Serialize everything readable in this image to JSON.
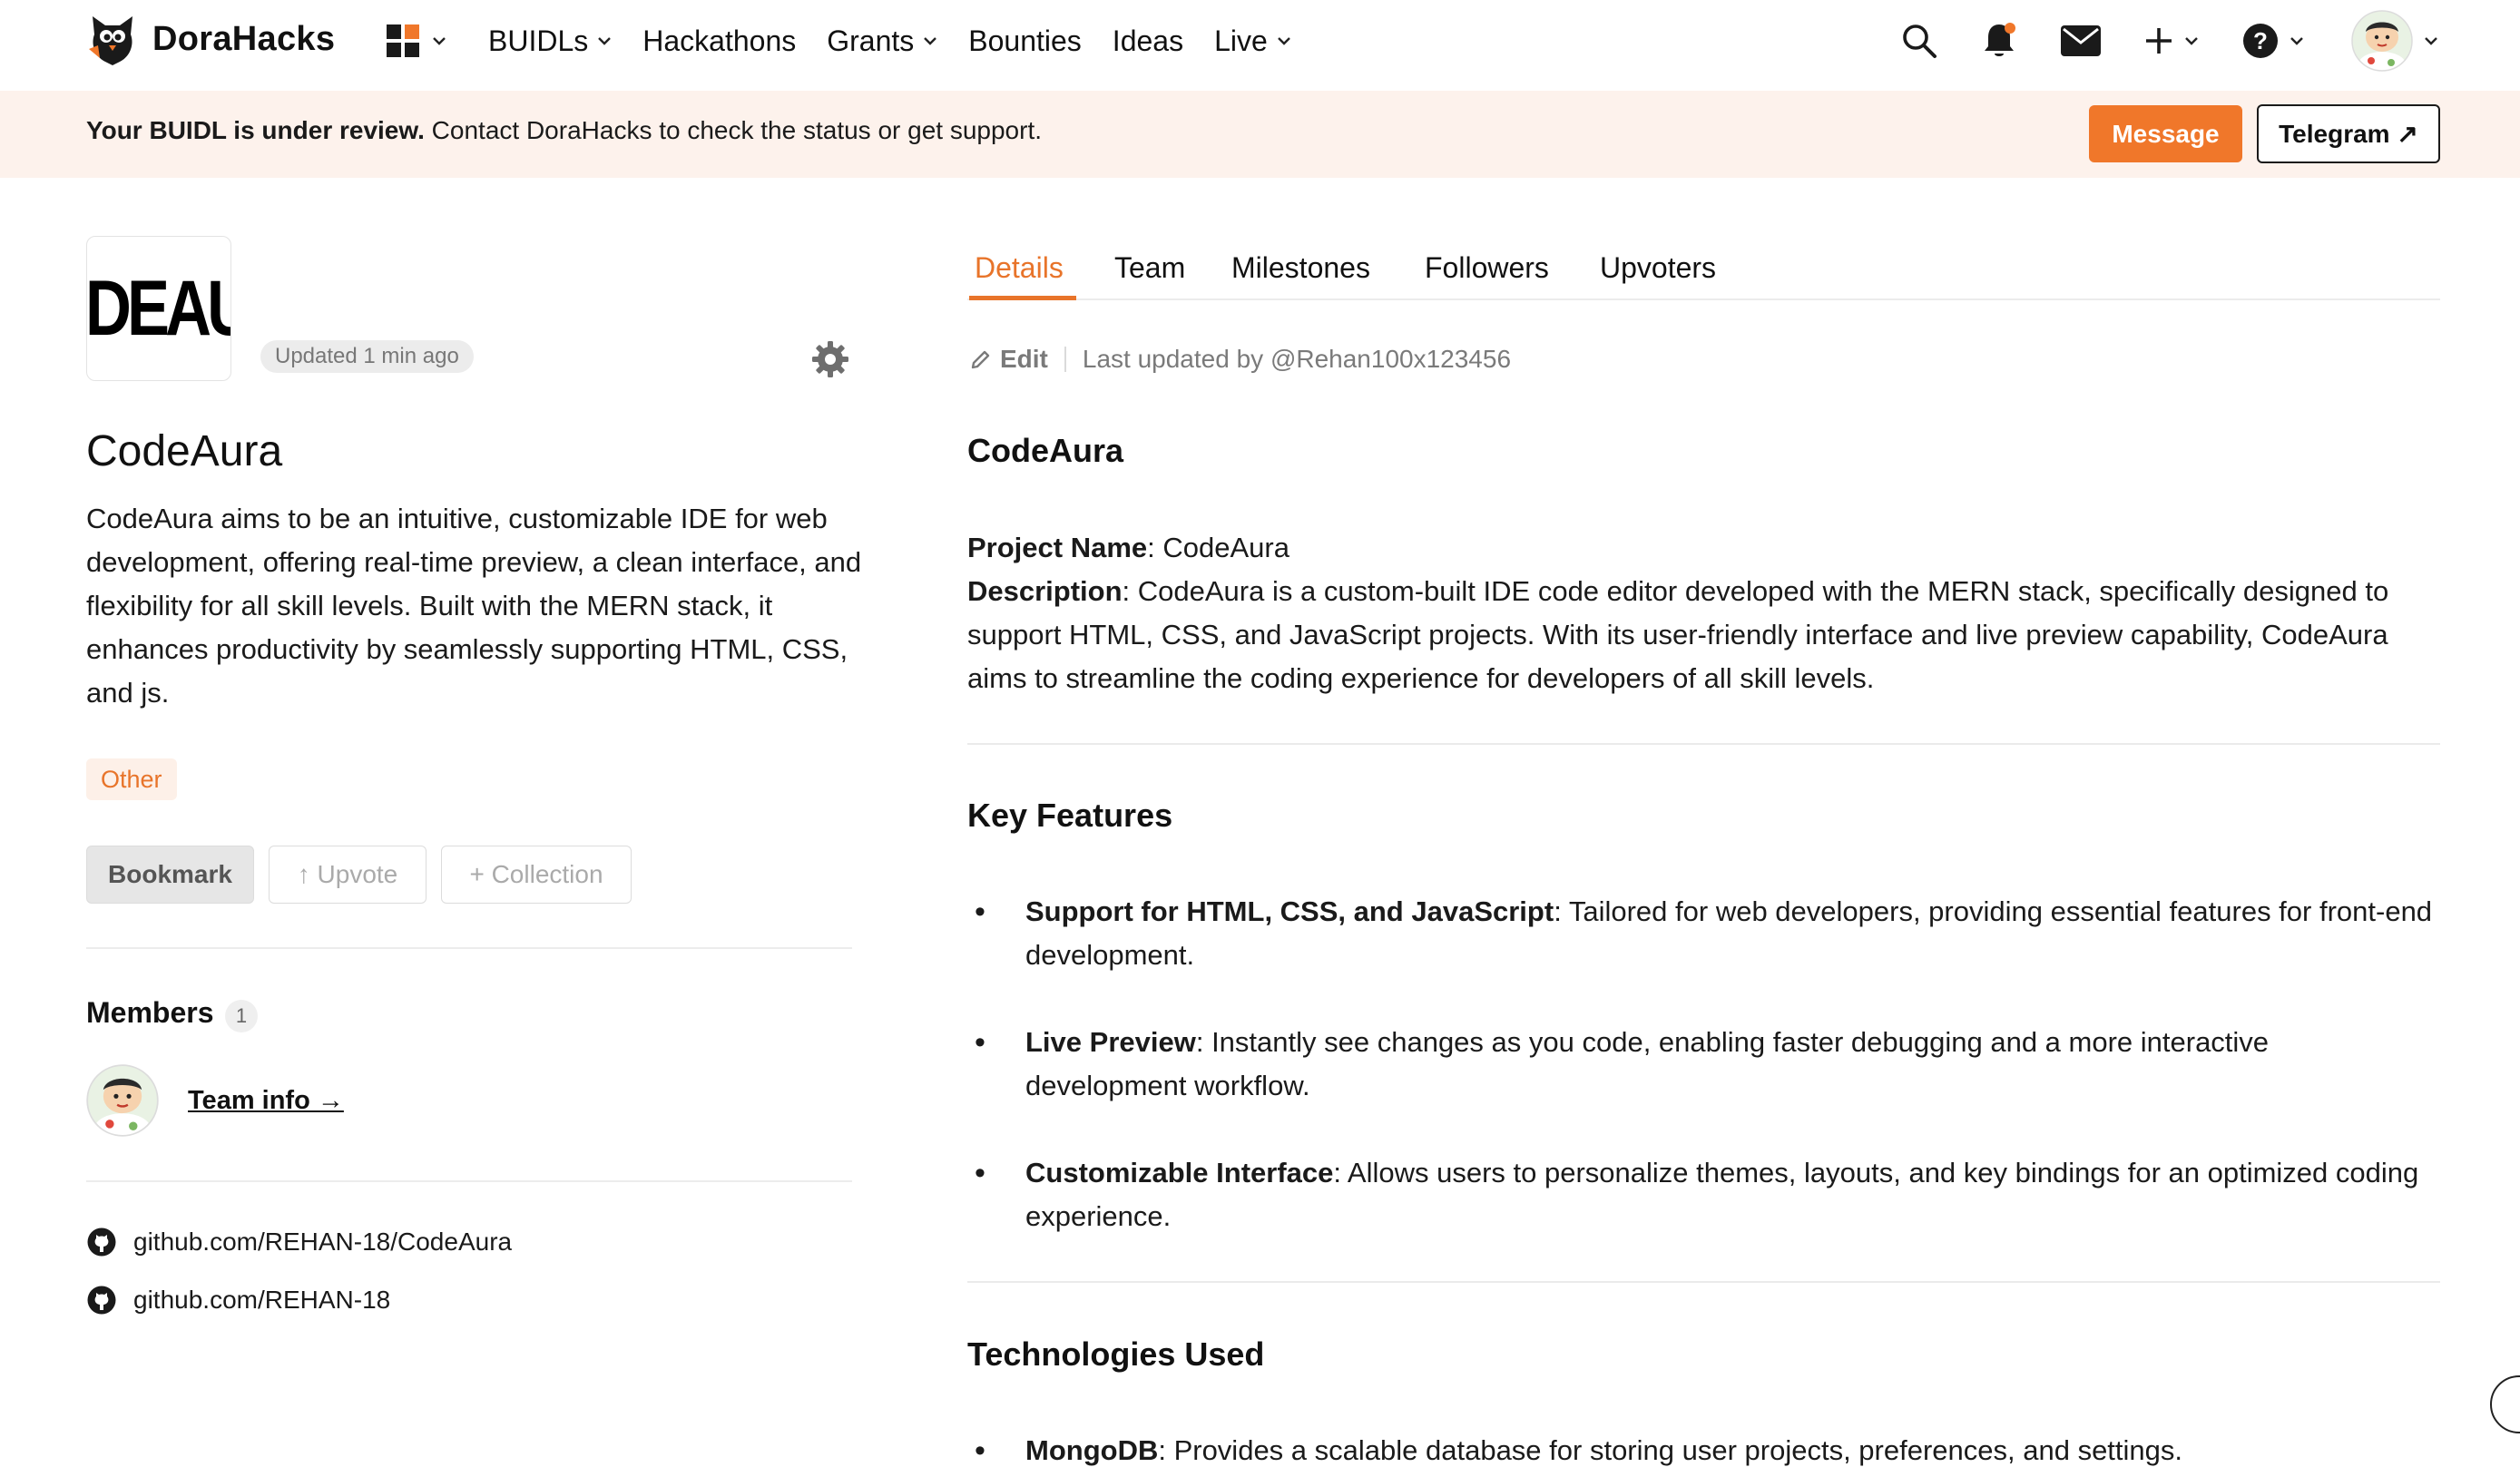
{
  "header": {
    "brand": "DoraHacks",
    "nav": [
      {
        "label": "BUIDLs",
        "has_dropdown": true
      },
      {
        "label": "Hackathons",
        "has_dropdown": false
      },
      {
        "label": "Grants",
        "has_dropdown": true
      },
      {
        "label": "Bounties",
        "has_dropdown": false
      },
      {
        "label": "Ideas",
        "has_dropdown": false
      },
      {
        "label": "Live",
        "has_dropdown": true
      }
    ],
    "icons": [
      "apps-grid-icon",
      "search-icon",
      "bell-icon",
      "mail-icon",
      "plus-icon",
      "help-icon",
      "user-avatar"
    ],
    "notification_dot_color": "#f0772a"
  },
  "banner": {
    "strong": "Your BUIDL is under review.",
    "text": " Contact DoraHacks to check the status or get support.",
    "message_label": "Message",
    "telegram_label": "Telegram ↗"
  },
  "project": {
    "logo_text": "DEAUI",
    "updated": "Updated 1 min ago",
    "title": "CodeAura",
    "description": "CodeAura aims to be an intuitive, customizable IDE for web development, offering real-time preview, a clean interface, and flexibility for all skill levels. Built with the MERN stack, it enhances productivity by seamlessly supporting HTML, CSS, and js.",
    "tag": "Other",
    "bookmark_label": "Bookmark",
    "upvote_label": "↑ Upvote",
    "collection_label": "+ Collection",
    "members_title": "Members",
    "members_count": "1",
    "team_info_label": "Team info →",
    "links": [
      "github.com/REHAN-18/CodeAura",
      "github.com/REHAN-18"
    ]
  },
  "tabs": [
    "Details",
    "Team",
    "Milestones",
    "Followers",
    "Upvoters"
  ],
  "details": {
    "edit_label": "Edit",
    "last_updated": "Last updated by @Rehan100x123456",
    "heading": "CodeAura",
    "project_name_label": "Project Name",
    "project_name_value": ": CodeAura",
    "description_label": "Description",
    "description_value": ": CodeAura is a custom-built IDE code editor developed with the MERN stack, specifically designed to support HTML, CSS, and JavaScript projects. With its user-friendly interface and live preview capability, CodeAura aims to streamline the coding experience for developers of all skill levels.",
    "key_features_title": "Key Features",
    "features": [
      {
        "title": "Support for HTML, CSS, and JavaScript",
        "text": ": Tailored for web developers, providing essential features for front-end development."
      },
      {
        "title": "Live Preview",
        "text": ": Instantly see changes as you code, enabling faster debugging and a more interactive development workflow."
      },
      {
        "title": "Customizable Interface",
        "text": ": Allows users to personalize themes, layouts, and key bindings for an optimized coding experience."
      }
    ],
    "tech_title": "Technologies Used",
    "technologies": [
      {
        "title": "MongoDB",
        "text": ": Provides a scalable database for storing user projects, preferences, and settings."
      }
    ]
  },
  "colors": {
    "accent": "#f0772a",
    "banner_bg": "#fdf2ec",
    "tag_bg": "#fdf0e8",
    "text": "#1a1a1a"
  }
}
